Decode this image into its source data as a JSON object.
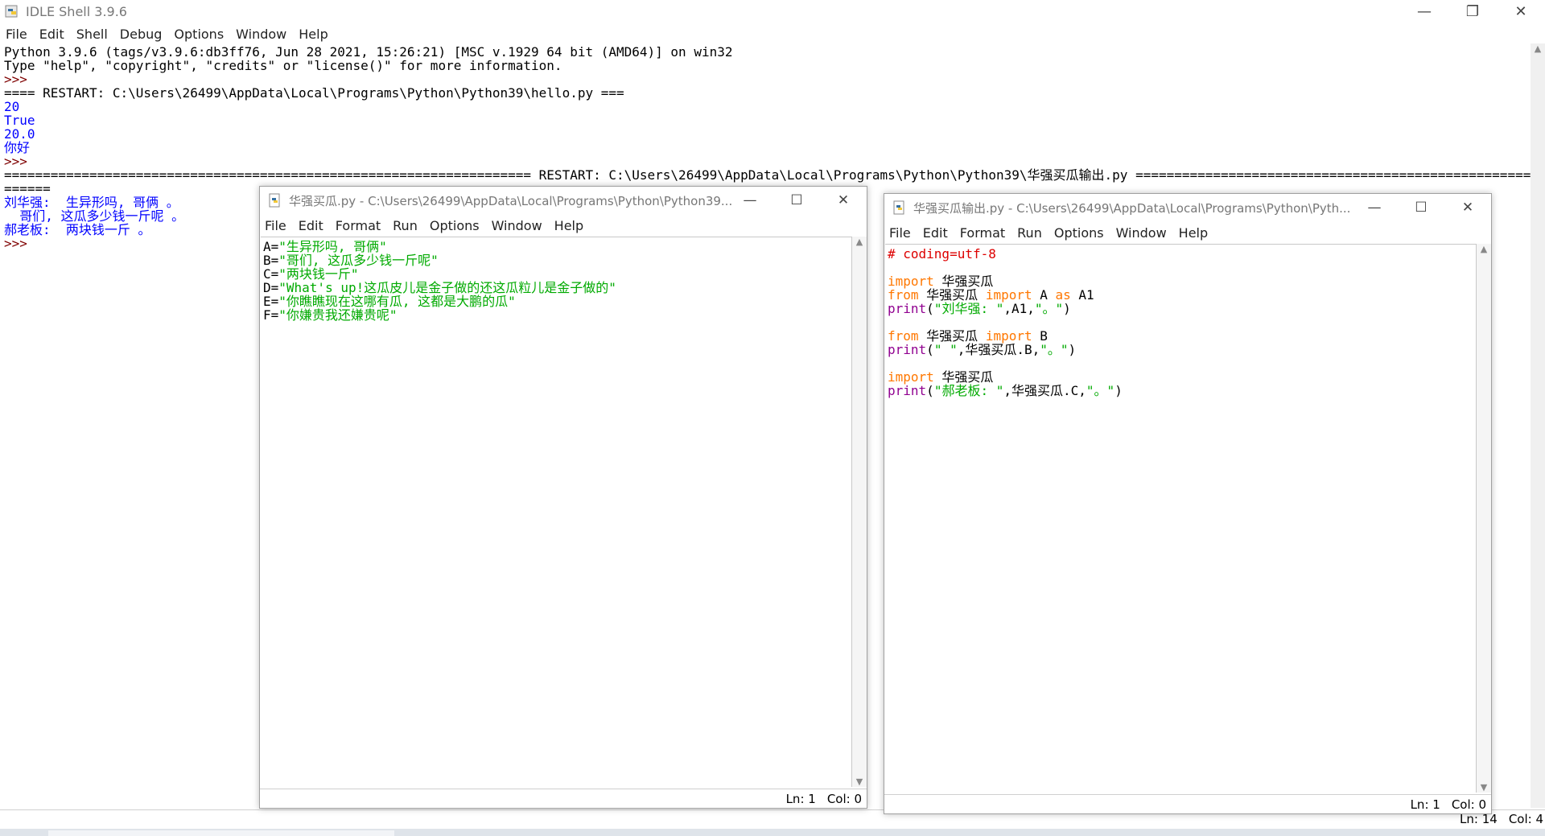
{
  "shell": {
    "title": "IDLE Shell 3.9.6",
    "menu": [
      "File",
      "Edit",
      "Shell",
      "Debug",
      "Options",
      "Window",
      "Help"
    ],
    "lines": [
      {
        "text": "Python 3.9.6 (tags/v3.9.6:db3ff76, Jun 28 2021, 15:26:21) [MSC v.1929 64 bit (AMD64)] on win32",
        "color": "black"
      },
      {
        "text": "Type \"help\", \"copyright\", \"credits\" or \"license()\" for more information.",
        "color": "black"
      },
      {
        "text": ">>>",
        "color": "darkred"
      },
      {
        "text": "==== RESTART: C:\\Users\\26499\\AppData\\Local\\Programs\\Python\\Python39\\hello.py ===",
        "color": "black"
      },
      {
        "text": "20",
        "color": "blue"
      },
      {
        "text": "True",
        "color": "blue"
      },
      {
        "text": "20.0",
        "color": "blue"
      },
      {
        "text": "你好",
        "color": "blue"
      },
      {
        "text": ">>>",
        "color": "darkred"
      },
      {
        "text": "==================================================================== RESTART: C:\\Users\\26499\\AppData\\Local\\Programs\\Python\\Python39\\华强买瓜输出.py ============================================================",
        "color": "black"
      },
      {
        "text": "======",
        "color": "black"
      },
      {
        "text": "刘华强:  生异形吗, 哥俩 。",
        "color": "blue"
      },
      {
        "text": "  哥们, 这瓜多少钱一斤呢 。",
        "color": "blue"
      },
      {
        "text": "郝老板:  两块钱一斤 。",
        "color": "blue"
      },
      {
        "text": ">>>",
        "color": "darkred"
      }
    ],
    "status": {
      "ln": "Ln: 14",
      "col": "Col: 4"
    }
  },
  "editor1": {
    "title": "华强买瓜.py - C:\\Users\\26499\\AppData\\Local\\Programs\\Python\\Python39...",
    "menu": [
      "File",
      "Edit",
      "Format",
      "Run",
      "Options",
      "Window",
      "Help"
    ],
    "lines": [
      [
        {
          "t": "A=",
          "c": "black"
        },
        {
          "t": "\"生异形吗, 哥俩\"",
          "c": "green"
        }
      ],
      [
        {
          "t": "B=",
          "c": "black"
        },
        {
          "t": "\"哥们, 这瓜多少钱一斤呢\"",
          "c": "green"
        }
      ],
      [
        {
          "t": "C=",
          "c": "black"
        },
        {
          "t": "\"两块钱一斤\"",
          "c": "green"
        }
      ],
      [
        {
          "t": "D=",
          "c": "black"
        },
        {
          "t": "\"What's up!这瓜皮儿是金子做的还这瓜粒儿是金子做的\"",
          "c": "green"
        }
      ],
      [
        {
          "t": "E=",
          "c": "black"
        },
        {
          "t": "\"你瞧瞧现在这哪有瓜, 这都是大鹏的瓜\"",
          "c": "green"
        }
      ],
      [
        {
          "t": "F=",
          "c": "black"
        },
        {
          "t": "\"你嫌贵我还嫌贵呢\"",
          "c": "green"
        }
      ]
    ],
    "status": {
      "ln": "Ln: 1",
      "col": "Col: 0"
    }
  },
  "editor2": {
    "title": "华强买瓜输出.py - C:\\Users\\26499\\AppData\\Local\\Programs\\Python\\Pyth...",
    "menu": [
      "File",
      "Edit",
      "Format",
      "Run",
      "Options",
      "Window",
      "Help"
    ],
    "lines": [
      [
        {
          "t": "# coding=utf-8",
          "c": "red"
        }
      ],
      [],
      [
        {
          "t": "import",
          "c": "orange"
        },
        {
          "t": " 华强买瓜",
          "c": "black"
        }
      ],
      [
        {
          "t": "from",
          "c": "orange"
        },
        {
          "t": " 华强买瓜 ",
          "c": "black"
        },
        {
          "t": "import",
          "c": "orange"
        },
        {
          "t": " A ",
          "c": "black"
        },
        {
          "t": "as",
          "c": "orange"
        },
        {
          "t": " A1",
          "c": "black"
        }
      ],
      [
        {
          "t": "print",
          "c": "purple"
        },
        {
          "t": "(",
          "c": "black"
        },
        {
          "t": "\"刘华强: \"",
          "c": "green"
        },
        {
          "t": ",A1,",
          "c": "black"
        },
        {
          "t": "\"。\"",
          "c": "green"
        },
        {
          "t": ")",
          "c": "black"
        }
      ],
      [],
      [
        {
          "t": "from",
          "c": "orange"
        },
        {
          "t": " 华强买瓜 ",
          "c": "black"
        },
        {
          "t": "import",
          "c": "orange"
        },
        {
          "t": " B",
          "c": "black"
        }
      ],
      [
        {
          "t": "print",
          "c": "purple"
        },
        {
          "t": "(",
          "c": "black"
        },
        {
          "t": "\" \"",
          "c": "green"
        },
        {
          "t": ",华强买瓜.B,",
          "c": "black"
        },
        {
          "t": "\"。\"",
          "c": "green"
        },
        {
          "t": ")",
          "c": "black"
        }
      ],
      [],
      [
        {
          "t": "import",
          "c": "orange"
        },
        {
          "t": " 华强买瓜",
          "c": "black"
        }
      ],
      [
        {
          "t": "print",
          "c": "purple"
        },
        {
          "t": "(",
          "c": "black"
        },
        {
          "t": "\"郝老板: \"",
          "c": "green"
        },
        {
          "t": ",华强买瓜.C,",
          "c": "black"
        },
        {
          "t": "\"。\"",
          "c": "green"
        },
        {
          "t": ")",
          "c": "black"
        }
      ]
    ],
    "status": {
      "ln": "Ln: 1",
      "col": "Col: 0"
    }
  },
  "window_controls": {
    "minimize": "—",
    "maximize": "☐",
    "restore": "❐",
    "close": "✕"
  },
  "icons": {
    "app": "python-idle-icon"
  }
}
